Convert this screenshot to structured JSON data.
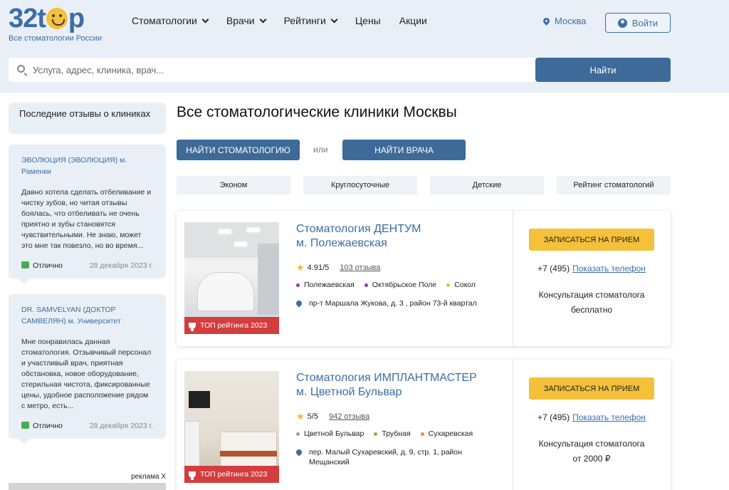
{
  "header": {
    "logo_text": "32t",
    "logo_text_end": "p",
    "logo_subtitle": "Все стоматологии России",
    "nav": [
      {
        "label": "Стоматологии",
        "dropdown": true
      },
      {
        "label": "Врачи",
        "dropdown": true
      },
      {
        "label": "Рейтинги",
        "dropdown": true
      },
      {
        "label": "Цены",
        "dropdown": false
      },
      {
        "label": "Акции",
        "dropdown": false
      }
    ],
    "city": "Москва",
    "login_label": "Войти"
  },
  "search": {
    "placeholder": "Услуга, адрес, клиника, врач...",
    "button_label": "Найти"
  },
  "sidebar": {
    "title": "Последние отзывы о клиниках",
    "reviews": [
      {
        "clinic": "ЭВОЛЮЦИЯ (ЭВОЛЮЦИЯ)",
        "metro": "м. Раменки",
        "text": "Давно хотела сделать отбеливание и чистку зубов, но читая отзывы боялась, что отбеливать не очень приятно и зубы становятся чувствительными. Не знаю, может это мне так повезло, но во время...",
        "verdict": "Отлично",
        "date": "28 декабря 2023 г."
      },
      {
        "clinic": "DR. SAMVELYAN (ДОКТОР САМВЕЛЯН)",
        "metro": "м. Университет",
        "text": "Мне понравилась данная стоматология. Отзывчивый персонал и участливый врач, приятная обстановка, новое оборудование, стерильная чистота, фиксированные цены, удобное расположение рядом с метро, есть...",
        "verdict": "Отлично",
        "date": "28 декабря 2023 г."
      }
    ],
    "ads_label": "реклама X"
  },
  "main": {
    "title": "Все стоматологические клиники Москвы",
    "find_clinic_label": "НАЙТИ СТОМАТОЛОГИЮ",
    "or_label": "или",
    "find_doctor_label": "НАЙТИ ВРАЧА",
    "filters": [
      "Эконом",
      "Круглосуточные",
      "Детские",
      "Рейтинг стоматологий"
    ]
  },
  "clinics": [
    {
      "name_line1": "Стоматология ДЕНТУМ",
      "name_line2": "м. Полежаевская",
      "rating": "4.91/5",
      "reviews": "103 отзыва",
      "metro": [
        {
          "name": "Полежаевская",
          "color": "#8e3aa6"
        },
        {
          "name": "Октябрьское Поле",
          "color": "#8e3aa6"
        },
        {
          "name": "Сокол",
          "color": "#7ab648"
        }
      ],
      "address": "пр-т Маршала Жукова, д. 3 , район 73-й квартал",
      "badge": "ТОП рейтинга 2023",
      "book_label": "ЗАПИСАТЬСЯ НА ПРИЕМ",
      "phone_prefix": "+7 (495)",
      "phone_link": "Показать телефон",
      "consult_line1": "Консультация стоматолога",
      "consult_line2": "бесплатно"
    },
    {
      "name_line1": "Стоматология ИМПЛАНТМАСТЕР",
      "name_line2": "м. Цветной Бульвар",
      "rating": "5/5",
      "reviews": "942 отзыва",
      "metro": [
        {
          "name": "Цветной Бульвар",
          "color": "#999999"
        },
        {
          "name": "Трубная",
          "color": "#7ab648"
        },
        {
          "name": "Сухаревская",
          "color": "#f08a24"
        }
      ],
      "address": "пер. Малый Сухаревский, д. 9, стр. 1, район Мещанский",
      "badge": "ТОП рейтинга 2023",
      "book_label": "ЗАПИСАТЬСЯ НА ПРИЕМ",
      "phone_prefix": "+7 (495)",
      "phone_link": "Показать телефон",
      "consult_line1": "Консультация стоматолога",
      "consult_line2": "от 2000 ₽"
    }
  ],
  "colors": {
    "accent": "#3d6a98",
    "link": "#3b6ea5",
    "cta": "#f5c03a",
    "badge": "#d43d3d",
    "header_bg": "#e8eff6"
  }
}
